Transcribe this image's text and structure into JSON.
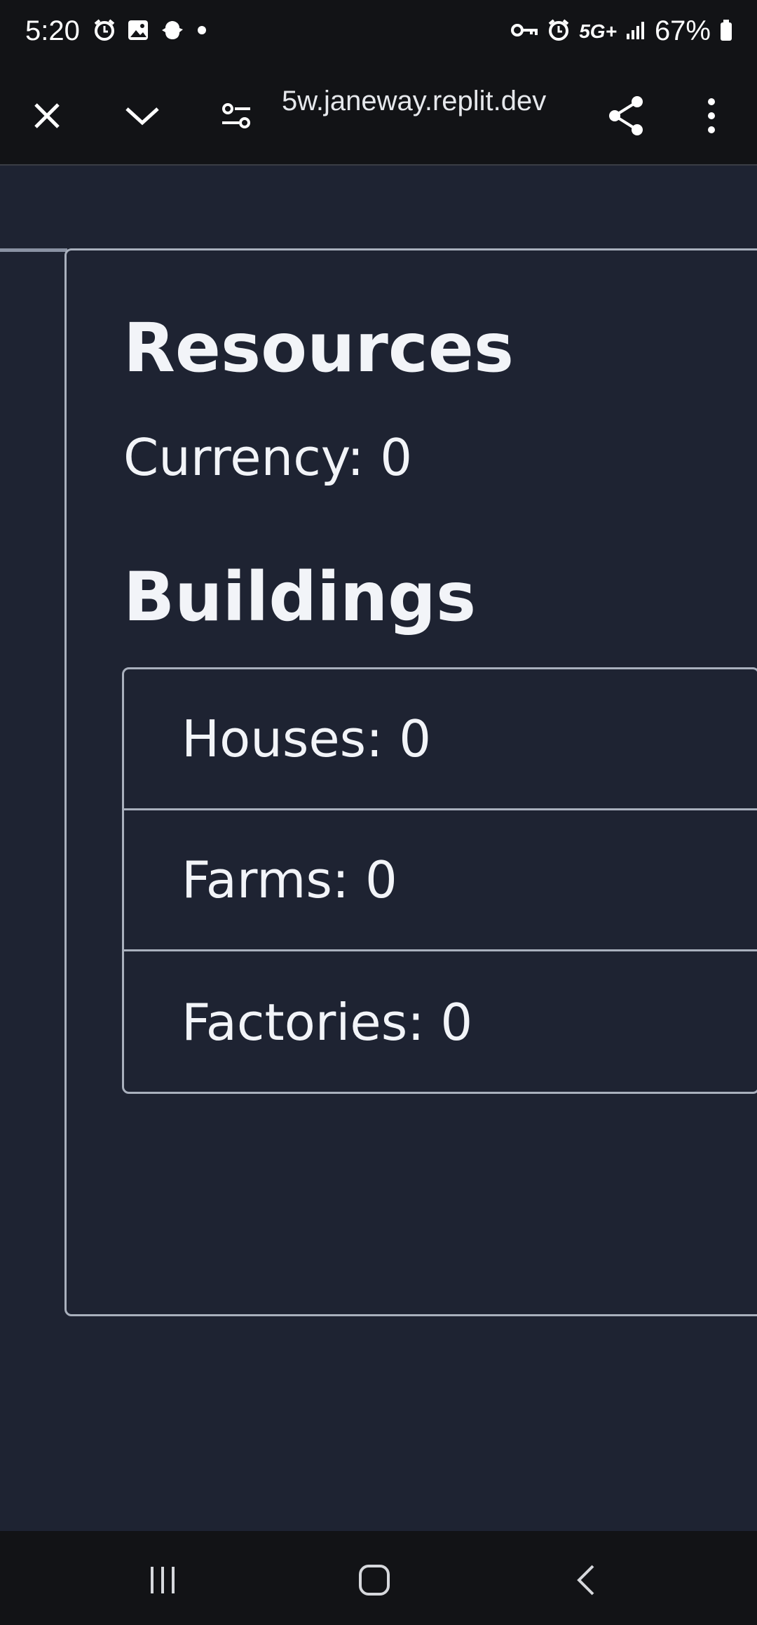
{
  "status_bar": {
    "time": "5:20",
    "network": "5G+",
    "battery": "67%",
    "left_icons": [
      "alarm-icon",
      "gallery-icon",
      "app-notification-icon",
      "dot-icon"
    ],
    "right_icons": [
      "vpn-key-icon",
      "alarm-icon",
      "signal-icon",
      "battery-icon"
    ]
  },
  "browser": {
    "url": "5w.janeway.replit.dev",
    "buttons": [
      "close-icon",
      "chevron-down-icon",
      "site-settings-icon",
      "share-icon",
      "more-icon"
    ]
  },
  "resources": {
    "title": "Resources",
    "currency": "Currency: 0"
  },
  "buildings": {
    "title": "Buildings",
    "items": [
      {
        "label": "Houses: 0"
      },
      {
        "label": "Farms: 0"
      },
      {
        "label": "Factories: 0"
      }
    ]
  },
  "nav_bar": {
    "buttons": [
      "recents-icon",
      "home-icon",
      "back-icon"
    ]
  },
  "colors": {
    "page_background": "#1e2332",
    "bar_background": "#121316",
    "border": "#a9b0bd",
    "text": "#f2f4f8"
  }
}
